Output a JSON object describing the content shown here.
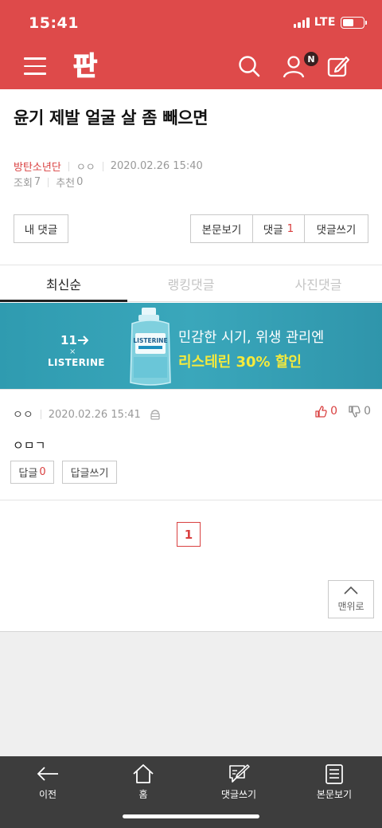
{
  "status": {
    "time": "15:41",
    "network": "LTE",
    "battery_level": 0.55
  },
  "header": {
    "logo_text": "판",
    "notification_badge": "N"
  },
  "post": {
    "title": "윤기 제발 얼굴 살 좀 빼으면",
    "category": "방탄소년단",
    "author": "ㅇㅇ",
    "datetime": "2020.02.26 15:40",
    "views_label": "조회",
    "views": "7",
    "likes_label": "추천",
    "likes": "0"
  },
  "actions": {
    "my_comments": "내 댓글",
    "view_post": "본문보기",
    "comments_label": "댓글",
    "comments_count": "1",
    "write_comment": "댓글쓰기"
  },
  "tabs": [
    {
      "label": "최신순",
      "active": true
    },
    {
      "label": "랭킹댓글",
      "active": false
    },
    {
      "label": "사진댓글",
      "active": false
    }
  ],
  "ad": {
    "brand_11st": "11",
    "times": "×",
    "brand_listerine": "LISTERINE",
    "line1": "민감한 시기, 위생 관리엔",
    "line2": "리스테린 30% 할인",
    "bottle_label": "LISTERINE"
  },
  "comment": {
    "author": "ㅇㅇ",
    "datetime": "2020.02.26 15:41",
    "up_count": "0",
    "down_count": "0",
    "text": "ㅇㅁㄱ",
    "reply_label": "답글",
    "reply_count": "0",
    "write_reply": "답글쓰기"
  },
  "pagination": {
    "current": "1"
  },
  "to_top": "맨위로",
  "bottom_nav": [
    {
      "label": "이전",
      "icon": "back-arrow-icon"
    },
    {
      "label": "홈",
      "icon": "home-icon"
    },
    {
      "label": "댓글쓰기",
      "icon": "comment-write-icon"
    },
    {
      "label": "본문보기",
      "icon": "document-icon"
    }
  ],
  "colors": {
    "brand_red": "#de4a4a",
    "accent_red": "#d94040",
    "ad_teal": "#3aa7bb",
    "ad_yellow": "#f5ea3c",
    "bottom_bar": "#3d3d3d"
  }
}
